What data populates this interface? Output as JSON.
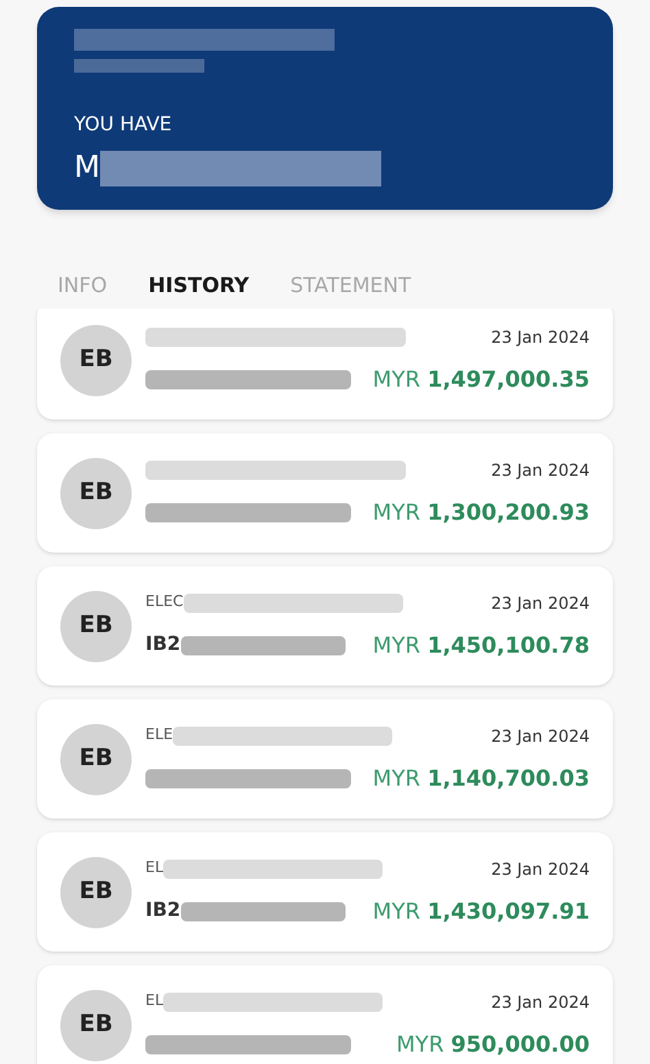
{
  "account_card": {
    "balance_label": "YOU HAVE",
    "balance_prefix": "M"
  },
  "tabs": [
    {
      "label": "INFO",
      "selected": false
    },
    {
      "label": "HISTORY",
      "selected": true
    },
    {
      "label": "STATEMENT",
      "selected": false
    }
  ],
  "transactions": [
    {
      "avatar": "EB",
      "date": "23 Jan 2024",
      "currency": "MYR",
      "amount": "1,497,000.35"
    },
    {
      "avatar": "EB",
      "date": "23 Jan 2024",
      "currency": "MYR",
      "amount": "1,300,200.93"
    },
    {
      "avatar": "EB",
      "name_prefix": "ELEC",
      "reference_prefix": "IB2",
      "date": "23 Jan 2024",
      "currency": "MYR",
      "amount": "1,450,100.78"
    },
    {
      "avatar": "EB",
      "name_prefix": "ELE",
      "date": "23 Jan 2024",
      "currency": "MYR",
      "amount": "1,140,700.03"
    },
    {
      "avatar": "EB",
      "name_prefix": "EL",
      "reference_prefix": "IB2",
      "date": "23 Jan 2024",
      "currency": "MYR",
      "amount": "1,430,097.91"
    },
    {
      "avatar": "EB",
      "name_prefix": "EL",
      "date": "23 Jan 2024",
      "currency": "MYR",
      "amount": "950,000.00"
    }
  ]
}
